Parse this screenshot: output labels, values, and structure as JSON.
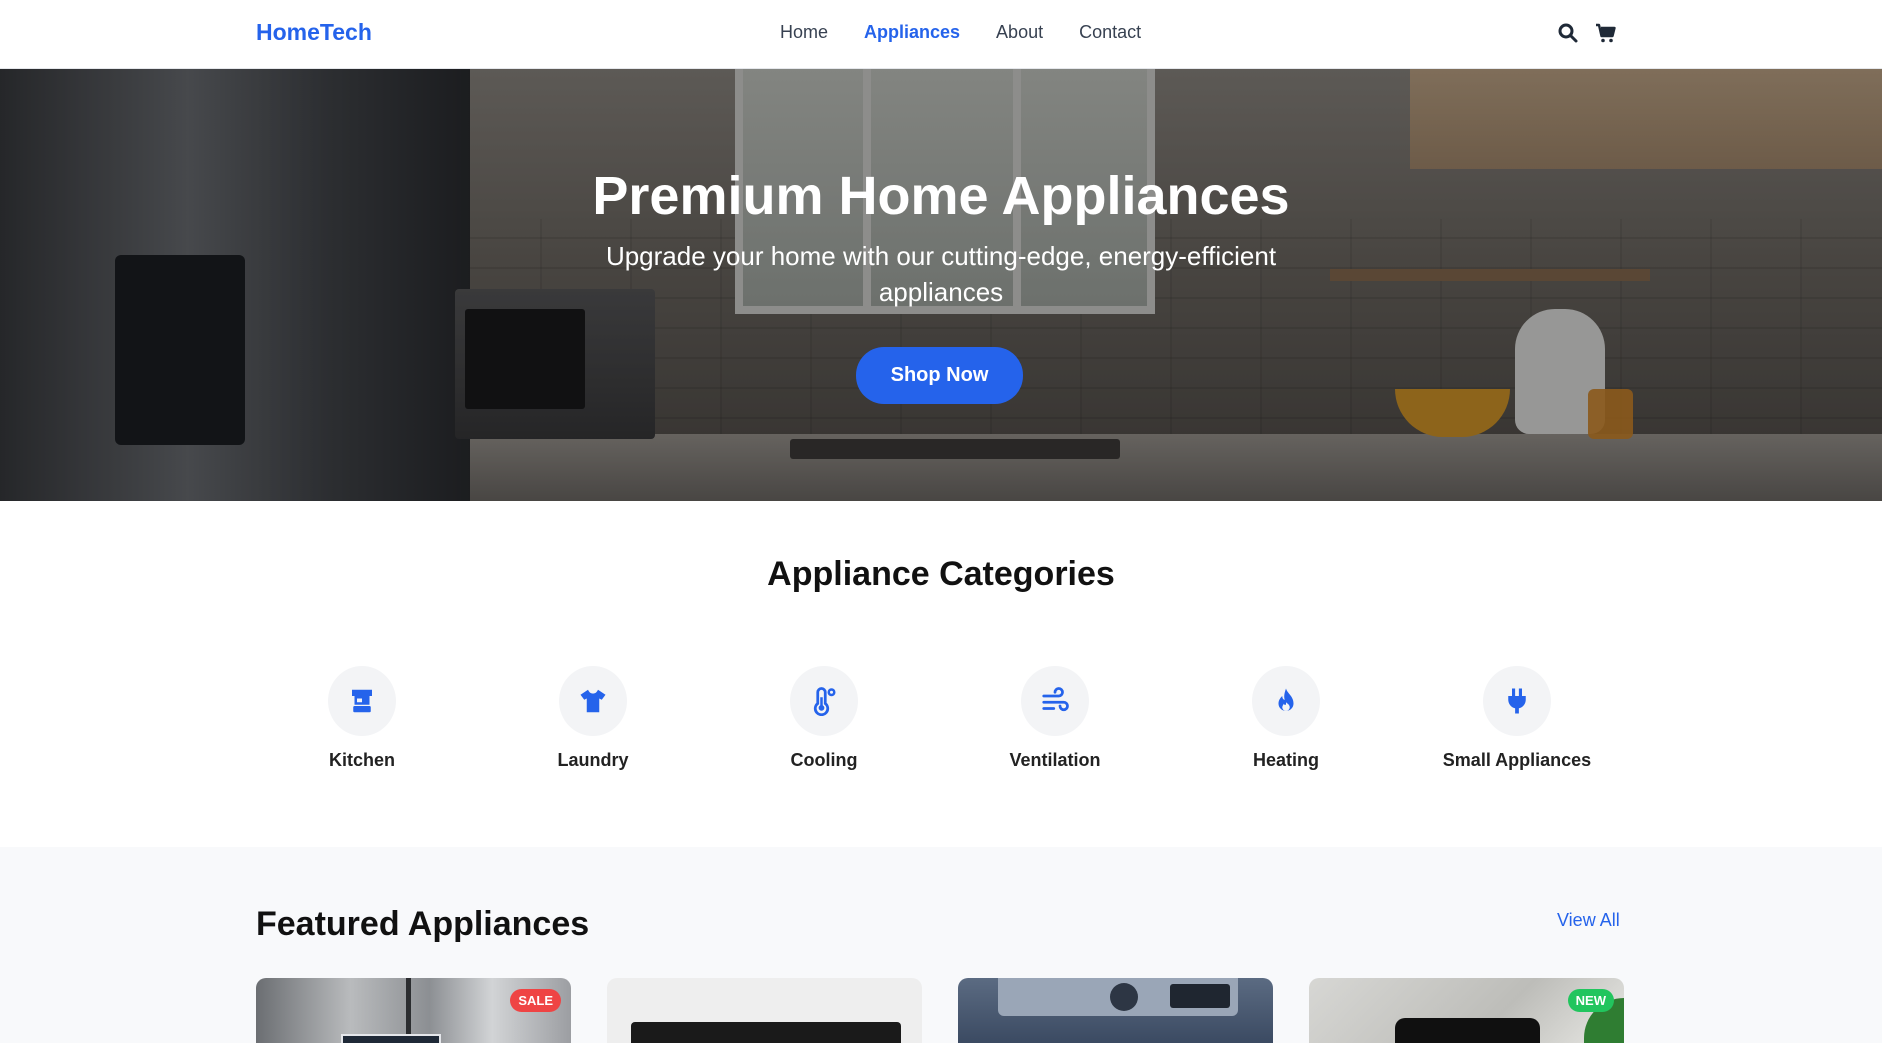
{
  "nav": {
    "logo": "HomeTech",
    "links": [
      {
        "label": "Home",
        "active": false
      },
      {
        "label": "Appliances",
        "active": true
      },
      {
        "label": "About",
        "active": false
      },
      {
        "label": "Contact",
        "active": false
      }
    ],
    "icons": [
      "search-icon",
      "cart-icon"
    ]
  },
  "hero": {
    "title": "Premium Home Appliances",
    "subtitle": "Upgrade your home with our cutting-edge, energy-efficient appliances",
    "cta": "Shop Now"
  },
  "categories": {
    "title": "Appliance Categories",
    "items": [
      {
        "label": "Kitchen",
        "icon": "blender-icon"
      },
      {
        "label": "Laundry",
        "icon": "shirt-icon"
      },
      {
        "label": "Cooling",
        "icon": "thermometer-icon"
      },
      {
        "label": "Ventilation",
        "icon": "wind-icon"
      },
      {
        "label": "Heating",
        "icon": "fire-icon"
      },
      {
        "label": "Small Appliances",
        "icon": "plug-icon"
      }
    ]
  },
  "featured": {
    "title": "Featured Appliances",
    "view_all": "View All",
    "cards": [
      {
        "badge": "SALE",
        "image": "refrigerator-image"
      },
      {
        "badge": "",
        "image": "cooktop-image"
      },
      {
        "badge": "",
        "image": "washing-machine-image"
      },
      {
        "badge": "NEW",
        "image": "air-fryer-image"
      }
    ]
  },
  "colors": {
    "accent": "#2563eb",
    "sale": "#ef4444",
    "new": "#22c55e",
    "category_bg": "#f3f4f6",
    "featured_bg": "#f8f9fb"
  }
}
